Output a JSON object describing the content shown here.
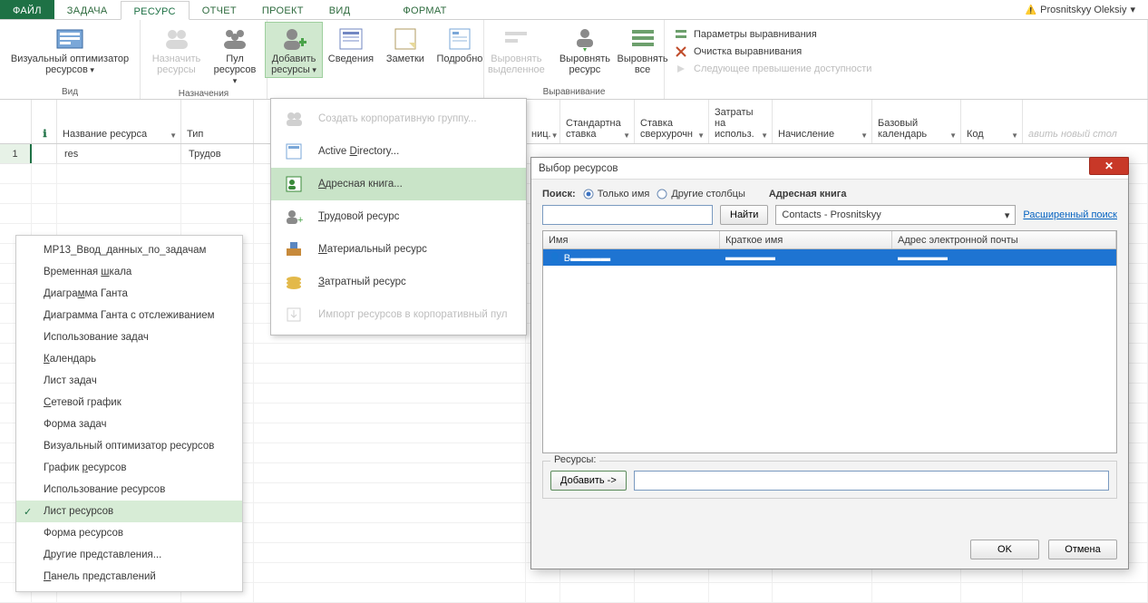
{
  "tabs": {
    "file": "ФАЙЛ",
    "task": "ЗАДАЧА",
    "resource": "РЕСУРС",
    "report": "ОТЧЕТ",
    "project": "ПРОЕКТ",
    "view": "ВИД",
    "format": "ФОРМАТ"
  },
  "user": {
    "name": "Prosnitskyy Oleksiy"
  },
  "ribbon": {
    "group_view": "Вид",
    "visual_optimizer": "Визуальный оптимизатор ресурсов",
    "group_assign": "Назначения",
    "assign": "Назначить ресурсы",
    "pool": "Пул ресурсов",
    "add": "Добавить ресурсы",
    "details": "Сведения",
    "notes": "Заметки",
    "more": "Подробно",
    "align_sel": "Выровнять выделенное",
    "align_res": "Выровнять ресурс",
    "align_all": "Выровнять все",
    "group_level": "Выравнивание",
    "opts": "Параметры выравнивания",
    "clear": "Очистка выравнивания",
    "next": "Следующее превышение доступности"
  },
  "columns": {
    "info": "i",
    "name": "Название ресурса",
    "type": "Тип",
    "units": "ниц.",
    "std_rate": "Стандартна ставка",
    "ot_rate": "Ставка сверхурочн",
    "cost_use": "Затраты на использ.",
    "accrual": "Начисление",
    "base_cal": "Базовый календарь",
    "code": "Код",
    "addnew": "авить новый стол"
  },
  "row1": {
    "num": "1",
    "name": "res",
    "type": "Трудов"
  },
  "menu_add": {
    "corp": "Создать корпоративную группу...",
    "ad": "Active Directory...",
    "ab": "Адресная книга...",
    "work": "Трудовой ресурс",
    "mat": "Материальный ресурс",
    "cost": "Затратный ресурс",
    "import": "Импорт ресурсов в корпоративный пул"
  },
  "menu_views": {
    "i0": "MP13_Ввод_данных_по_задачам",
    "i1": "Временная шкала",
    "i2": "Диаграмма Ганта",
    "i3": "Диаграмма Ганта с отслеживанием",
    "i4": "Использование задач",
    "i5": "Календарь",
    "i6": "Лист задач",
    "i7": "Сетевой график",
    "i8": "Форма задач",
    "i9": "Визуальный оптимизатор ресурсов",
    "i10": "График ресурсов",
    "i11": "Использование ресурсов",
    "i12": "Лист ресурсов",
    "i13": "Форма ресурсов",
    "i14": "Другие представления...",
    "i15": "Панель представлений"
  },
  "dialog": {
    "title": "Выбор ресурсов",
    "search": "Поиск:",
    "only_name": "Только имя",
    "other_cols": "Другие столбцы",
    "ab_label": "Адресная книга",
    "find": "Найти",
    "contacts": "Contacts - Prosnitskyy",
    "ext": "Расширенный поиск",
    "col_name": "Имя",
    "col_short": "Краткое имя",
    "col_email": "Адрес электронной почты",
    "row_name": "В",
    "row_short": "",
    "row_email": "",
    "res_legend": "Ресурсы:",
    "add_btn": "Добавить ->",
    "ok": "OK",
    "cancel": "Отмена"
  }
}
